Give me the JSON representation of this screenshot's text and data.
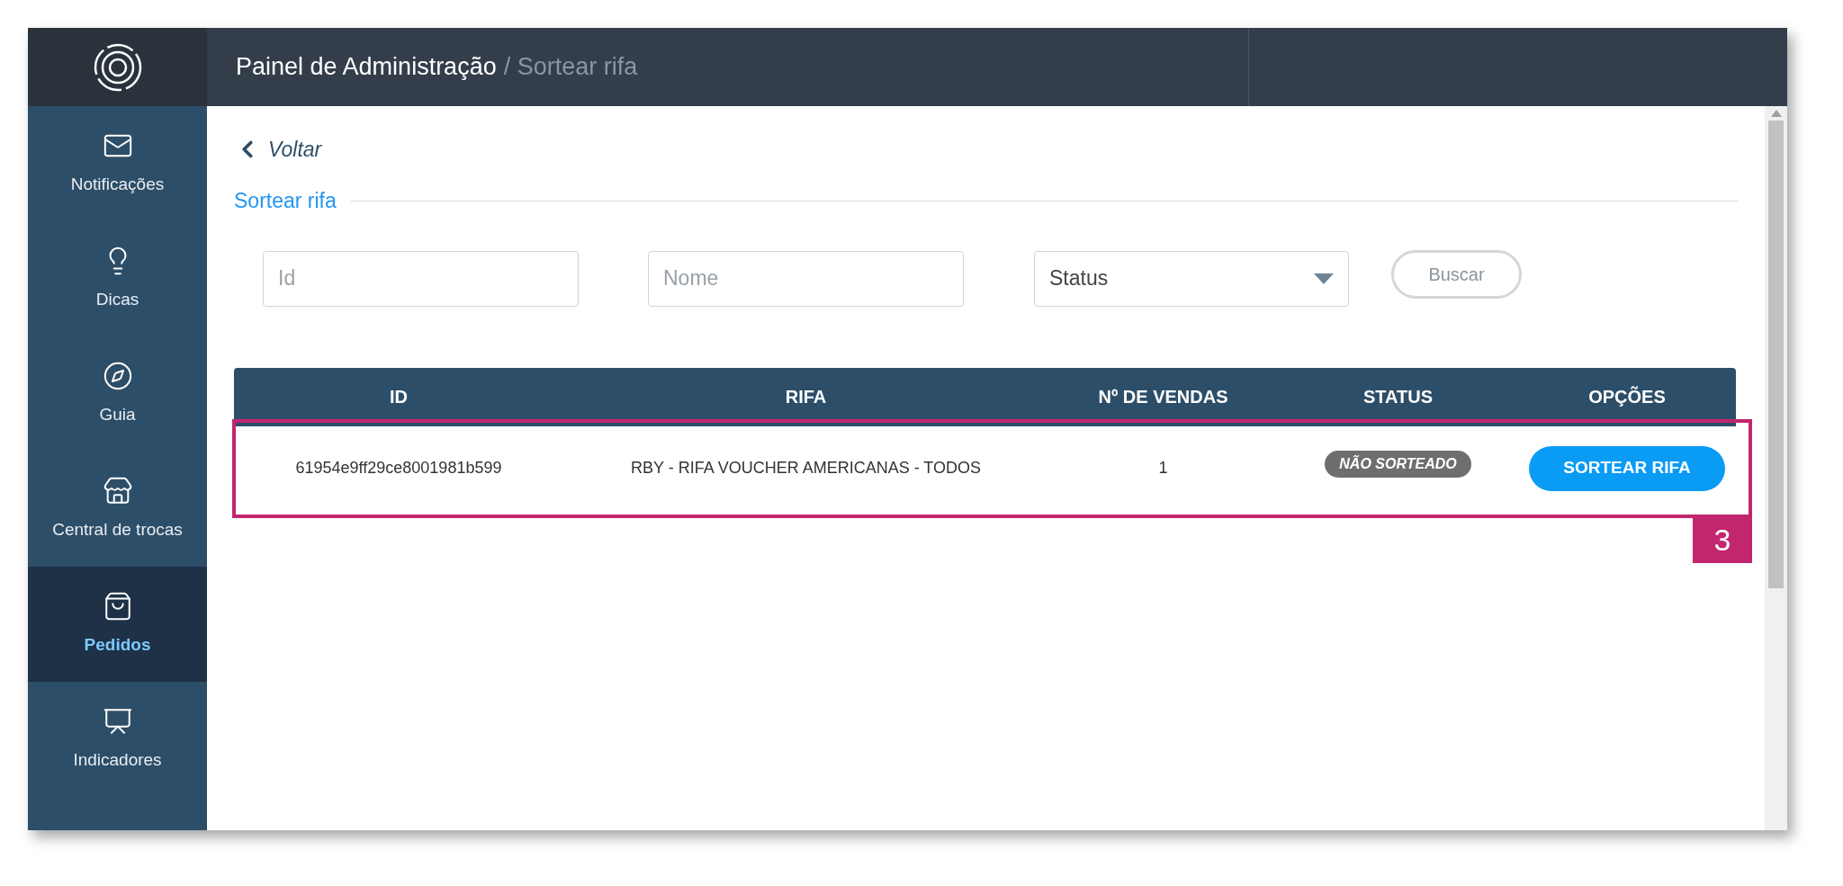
{
  "header": {
    "title": "Painel de Administração",
    "subtitle": "/ Sortear rifa"
  },
  "sidebar": {
    "items": [
      {
        "label": "Notificações",
        "selected": false
      },
      {
        "label": "Dicas",
        "selected": false
      },
      {
        "label": "Guia",
        "selected": false
      },
      {
        "label": "Central de trocas",
        "selected": false
      },
      {
        "label": "Pedidos",
        "selected": true
      },
      {
        "label": "Indicadores",
        "selected": false
      }
    ]
  },
  "back_link": "Voltar",
  "section_title": "Sortear rifa",
  "filters": {
    "id": {
      "placeholder": "Id"
    },
    "nome": {
      "placeholder": "Nome"
    },
    "status": {
      "value": "Status"
    },
    "button": "Buscar"
  },
  "table": {
    "columns": [
      "ID",
      "RIFA",
      "Nº DE VENDAS",
      "STATUS",
      "OPÇÕES"
    ],
    "rows": [
      {
        "id": "61954e9ff29ce8001981b599",
        "rifa": "RBY - RIFA VOUCHER AMERICANAS - TODOS",
        "vendas": "1",
        "status": "NÃO SORTEADO",
        "action": "SORTEAR RIFA"
      }
    ]
  },
  "callout": {
    "number": "3"
  }
}
